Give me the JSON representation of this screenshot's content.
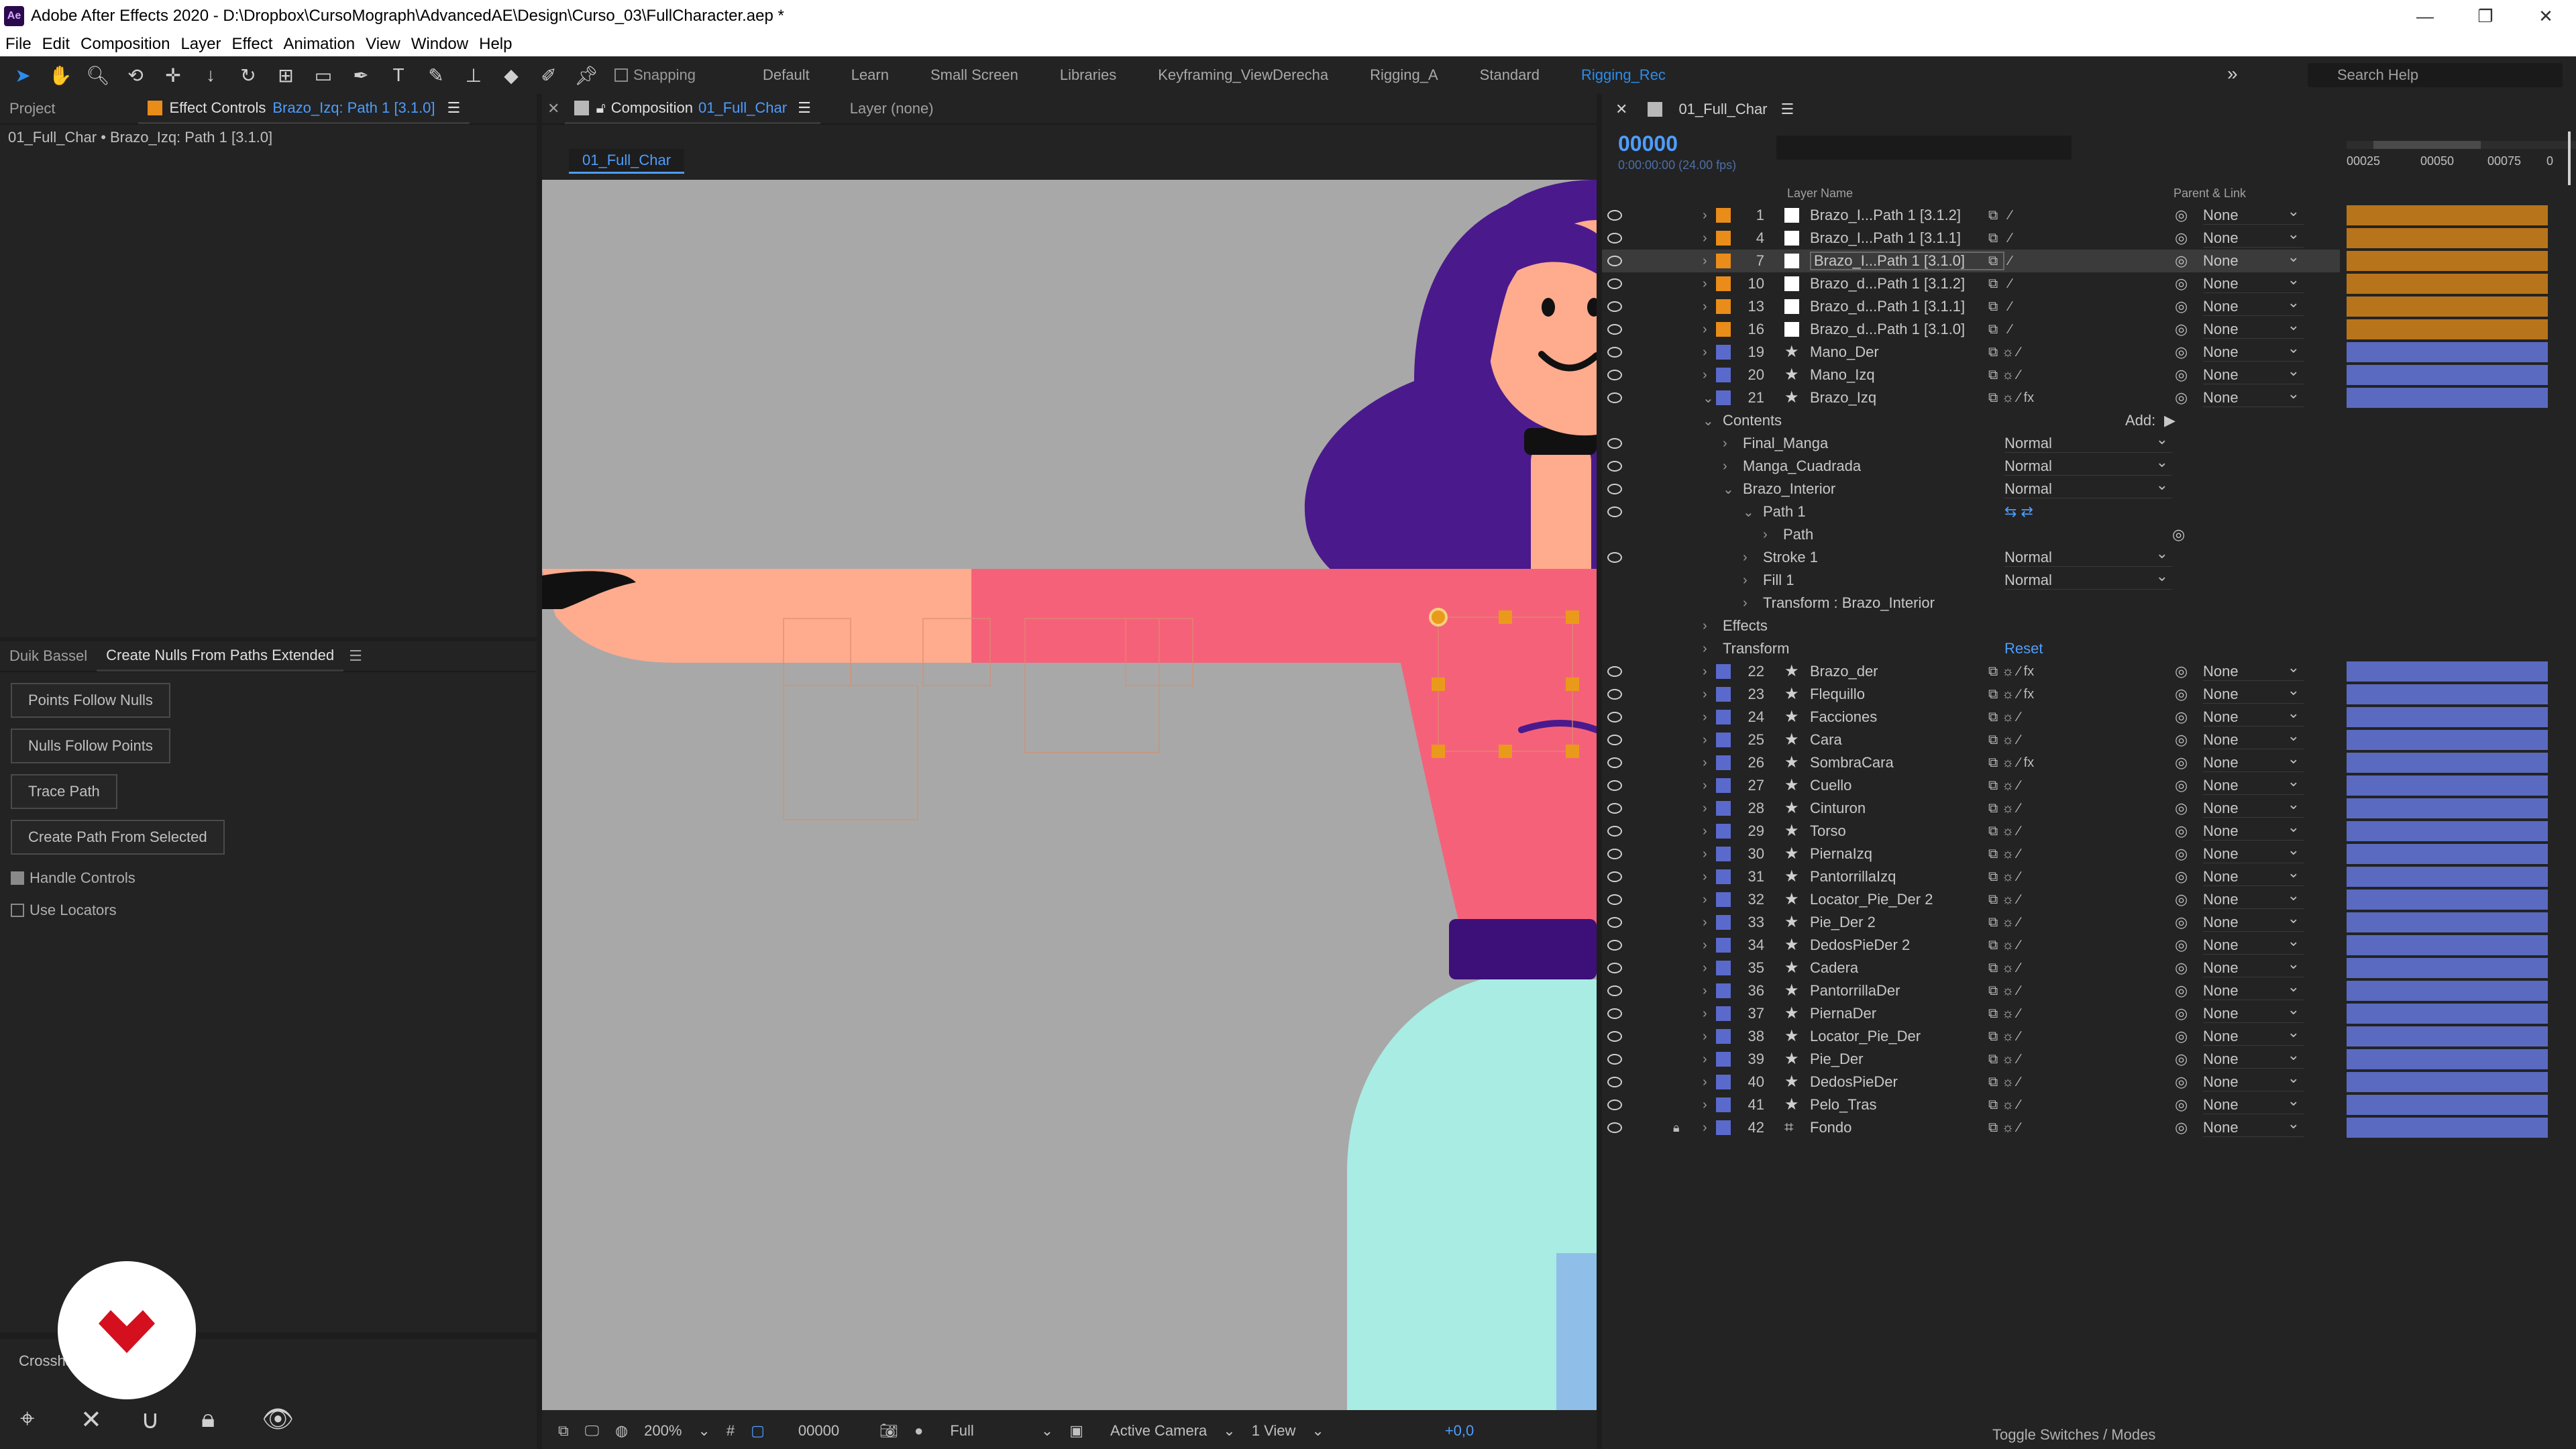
{
  "window": {
    "app_icon": "Ae",
    "title": "Adobe After Effects 2020 - D:\\Dropbox\\CursoMograph\\AdvancedAE\\Design\\Curso_03\\FullCharacter.aep *",
    "controls": [
      "—",
      "❐",
      "✕"
    ]
  },
  "menu": [
    "File",
    "Edit",
    "Composition",
    "Layer",
    "Effect",
    "Animation",
    "View",
    "Window",
    "Help"
  ],
  "toolbar": {
    "snapping_label": "Snapping",
    "workspaces": [
      "Default",
      "Learn",
      "Small Screen",
      "Libraries",
      "Keyframing_ViewDerecha",
      "Rigging_A",
      "Standard",
      "Rigging_Rec"
    ],
    "active_workspace": "Rigging_Rec",
    "overflow": "»",
    "search_placeholder": "Search Help"
  },
  "left_panel": {
    "project_tab": "Project",
    "effect_controls_tab": "Effect Controls",
    "effect_controls_target": "Brazo_Izq: Path 1 [3.1.0]",
    "breadcrumb": "01_Full_Char • Brazo_Izq: Path 1 [3.1.0]"
  },
  "script_panel": {
    "tabs": [
      "Duik Bassel",
      "Create Nulls From Paths Extended"
    ],
    "buttons": [
      "Points Follow Nulls",
      "Nulls Follow Points",
      "Trace Path",
      "Create Path From Selected"
    ],
    "checkboxes": [
      {
        "label": "Handle Controls",
        "checked": true
      },
      {
        "label": "Use Locators",
        "checked": false
      }
    ]
  },
  "crosshair_panel": {
    "tab": "Crossha"
  },
  "composition": {
    "tab_prefix": "Composition",
    "tab_name": "01_Full_Char",
    "layer_tab": "Layer  (none)",
    "subtab": "01_Full_Char",
    "viewer_bar": {
      "zoom": "200%",
      "timecode": "00000",
      "resolution": "Full",
      "camera": "Active Camera",
      "views": "1 View",
      "exposure": "+0,0"
    },
    "colors": {
      "background": "#a8a8a8",
      "skin": "#ffab8e",
      "shirt": "#f6617a",
      "hair": "#4a1a8c",
      "belt": "#3d0f78",
      "pants": "#a8ece4"
    }
  },
  "timeline": {
    "tab": "01_Full_Char",
    "timecode": "00000",
    "fps": "0:00:00:00 (24.00 fps)",
    "columns": {
      "layer_name": "Layer Name",
      "parent_link": "Parent & Link"
    },
    "ruler_ticks": [
      "00025",
      "00050",
      "00075",
      "0"
    ],
    "add_label": "Add:",
    "reset_label": "Reset",
    "toggle_label": "Toggle Switches / Modes",
    "layers_top": [
      {
        "num": "1",
        "name": "Brazo_I...Path 1 [3.1.2]",
        "label": "#ea8c19",
        "icon": "solid",
        "parent": "None"
      },
      {
        "num": "4",
        "name": "Brazo_I...Path 1 [3.1.1]",
        "label": "#ea8c19",
        "icon": "solid",
        "parent": "None"
      },
      {
        "num": "7",
        "name": "Brazo_I...Path 1 [3.1.0]",
        "label": "#ea8c19",
        "icon": "solid",
        "parent": "None",
        "selected": true
      },
      {
        "num": "10",
        "name": "Brazo_d...Path 1 [3.1.2]",
        "label": "#ea8c19",
        "icon": "solid",
        "parent": "None"
      },
      {
        "num": "13",
        "name": "Brazo_d...Path 1 [3.1.1]",
        "label": "#ea8c19",
        "icon": "solid",
        "parent": "None"
      },
      {
        "num": "16",
        "name": "Brazo_d...Path 1 [3.1.0]",
        "label": "#ea8c19",
        "icon": "solid",
        "parent": "None"
      },
      {
        "num": "19",
        "name": "Mano_Der",
        "label": "#5a6acc",
        "icon": "star",
        "parent": "None"
      },
      {
        "num": "20",
        "name": "Mano_Izq",
        "label": "#5a6acc",
        "icon": "star",
        "parent": "None"
      },
      {
        "num": "21",
        "name": "Brazo_Izq",
        "label": "#5a6acc",
        "icon": "star",
        "parent": "None",
        "expanded": true,
        "fx": true
      }
    ],
    "contents": {
      "contents_label": "Contents",
      "groups": [
        {
          "name": "Final_Manga",
          "mode": "Normal",
          "indent": 0
        },
        {
          "name": "Manga_Cuadrada",
          "mode": "Normal",
          "indent": 0
        },
        {
          "name": "Brazo_Interior",
          "mode": "Normal",
          "indent": 0,
          "open": true
        }
      ],
      "path_label": "Path 1",
      "path_prop": "Path",
      "stroke": {
        "name": "Stroke 1",
        "mode": "Normal"
      },
      "fill": {
        "name": "Fill 1",
        "mode": "Normal"
      },
      "transform_group": "Transform : Brazo_Interior",
      "effects_label": "Effects",
      "transform_label": "Transform"
    },
    "layers_bottom": [
      {
        "num": "22",
        "name": "Brazo_der",
        "fx": true
      },
      {
        "num": "23",
        "name": "Flequillo",
        "fx": true
      },
      {
        "num": "24",
        "name": "Facciones"
      },
      {
        "num": "25",
        "name": "Cara"
      },
      {
        "num": "26",
        "name": "SombraCara",
        "fx": true
      },
      {
        "num": "27",
        "name": "Cuello"
      },
      {
        "num": "28",
        "name": "Cinturon"
      },
      {
        "num": "29",
        "name": "Torso"
      },
      {
        "num": "30",
        "name": "PiernaIzq"
      },
      {
        "num": "31",
        "name": "PantorrillaIzq"
      },
      {
        "num": "32",
        "name": "Locator_Pie_Der 2"
      },
      {
        "num": "33",
        "name": "Pie_Der 2"
      },
      {
        "num": "34",
        "name": "DedosPieDer 2"
      },
      {
        "num": "35",
        "name": "Cadera"
      },
      {
        "num": "36",
        "name": "PantorrillaDer"
      },
      {
        "num": "37",
        "name": "PiernaDer"
      },
      {
        "num": "38",
        "name": "Locator_Pie_Der"
      },
      {
        "num": "39",
        "name": "Pie_Der"
      },
      {
        "num": "40",
        "name": "DedosPieDer"
      },
      {
        "num": "41",
        "name": "Pelo_Tras"
      },
      {
        "num": "42",
        "name": "Fondo",
        "locked": true,
        "icon": "null"
      }
    ],
    "parent_default": "None"
  }
}
